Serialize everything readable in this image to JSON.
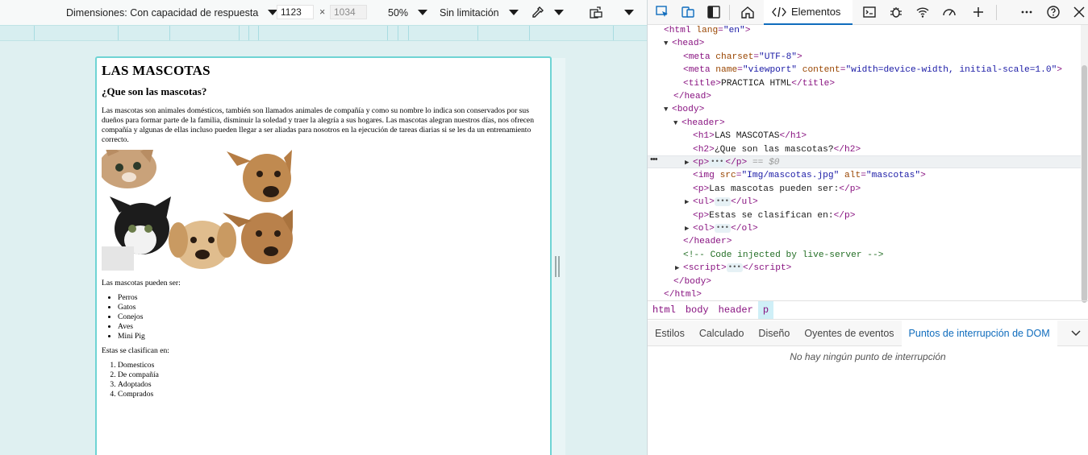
{
  "emulation": {
    "device_label": "Dimensiones: Con capacidad de respuesta",
    "width_value": "1123",
    "times": "×",
    "height_value": "1034",
    "zoom": "50%",
    "throttling": "Sin limitación"
  },
  "page": {
    "h1": "LAS MASCOTAS",
    "h2": "¿Que son las mascotas?",
    "paragraph": "Las mascotas son animales domésticos, también son llamados animales de compañía y como su nombre lo indica son conservados por sus dueños para formar parte de la familia, disminuir la soledad y traer la alegría a sus hogares. Las mascotas alegran nuestros días, nos ofrecen compañía y algunas de ellas incluso pueden llegar a ser aliadas para nosotros en la ejecución de tareas diarias si se les da un entrenamiento correcto.",
    "image_alt": "mascotas",
    "list_intro": "Las mascotas pueden ser:",
    "ul_items": [
      "Perros",
      "Gatos",
      "Conejos",
      "Aves",
      "Mini Pig"
    ],
    "ol_intro": "Estas se clasifican en:",
    "ol_items": [
      "Domesticos",
      "De compañía",
      "Adoptados",
      "Comprados"
    ]
  },
  "devtools": {
    "elements_tab": "Elementos",
    "dom": {
      "html_open_tag": "html",
      "html_lang_attr": "lang",
      "html_lang_val": "\"en\"",
      "head": "head",
      "meta": "meta",
      "charset_attr": "charset",
      "charset_val": "\"UTF-8\"",
      "name_attr": "name",
      "name_val": "\"viewport\"",
      "content_attr": "content",
      "content_val": "\"width=device-width, initial-scale=1.0\"",
      "title": "title",
      "title_text": "PRACTICA HTML",
      "body": "body",
      "header": "header",
      "h1": "h1",
      "h1_text": "LAS MASCOTAS",
      "h2": "h2",
      "h2_text": "¿Que son las mascotas?",
      "p": "p",
      "selected_suffix": "== $0",
      "img": "img",
      "src_attr": "src",
      "src_val": "\"Img/mascotas.jpg\"",
      "alt_attr": "alt",
      "alt_val": "\"mascotas\"",
      "p2_text": "Las mascotas pueden ser:",
      "ul": "ul",
      "p3_text": "Estas se clasifican en:",
      "ol": "ol",
      "comment": "<!-- Code injected by live-server -->",
      "script": "script"
    },
    "breadcrumbs": [
      "html",
      "body",
      "header",
      "p"
    ],
    "subtabs": [
      "Estilos",
      "Calculado",
      "Diseño",
      "Oyentes de eventos",
      "Puntos de interrupción de DOM"
    ],
    "empty_message": "No hay ningún punto de interrupción"
  }
}
